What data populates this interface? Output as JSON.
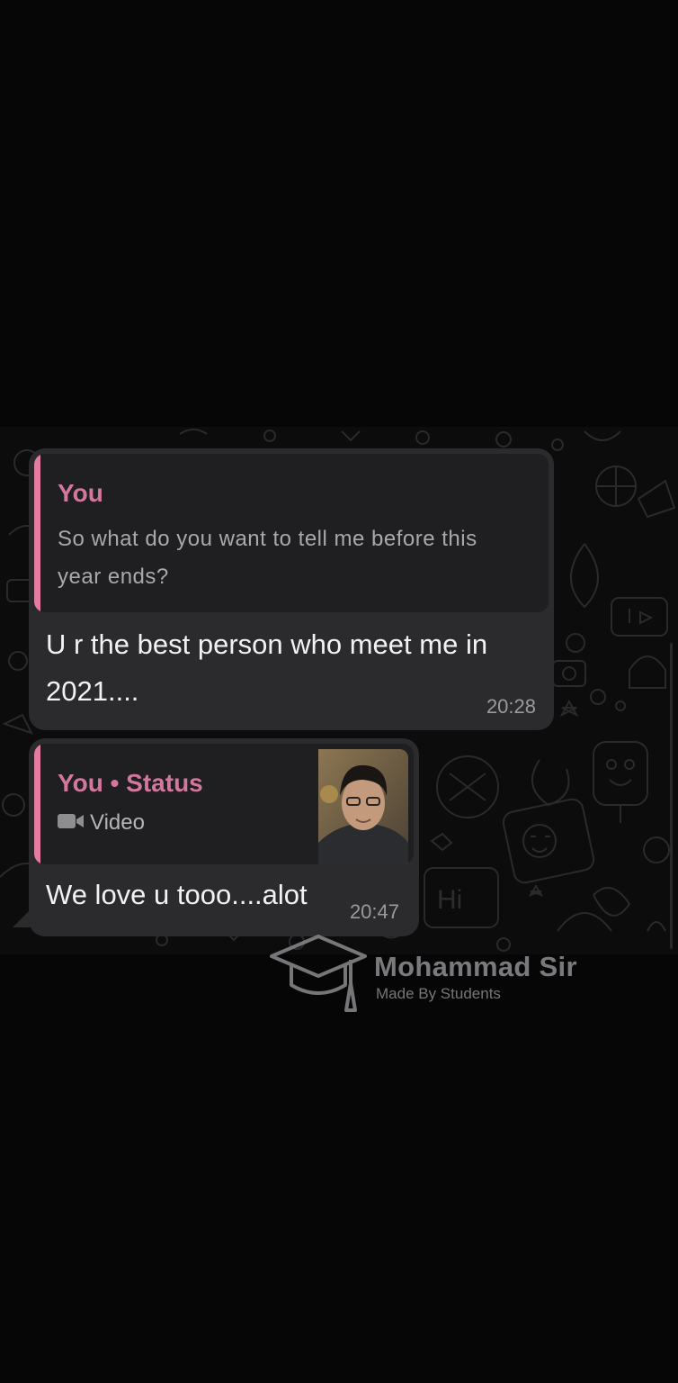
{
  "chat": {
    "messages": [
      {
        "quote_author": "You",
        "quote_text": "So what do you want to tell me before this year ends?",
        "text": "U r the best person who meet me in 2021....",
        "time": "20:28"
      },
      {
        "quote_author": "You • Status",
        "quote_media_label": "Video",
        "quote_media_icon": "video-camera-icon",
        "text": "We love u tooo....alot",
        "time": "20:47"
      }
    ]
  },
  "watermark": {
    "title": "Mohammad Sir",
    "subtitle": "Made By Students",
    "icon": "graduation-cap-icon"
  },
  "colors": {
    "accent": "#e47ca2",
    "bubble": "#2b2b2d",
    "quote_bg": "#1f1f21"
  }
}
